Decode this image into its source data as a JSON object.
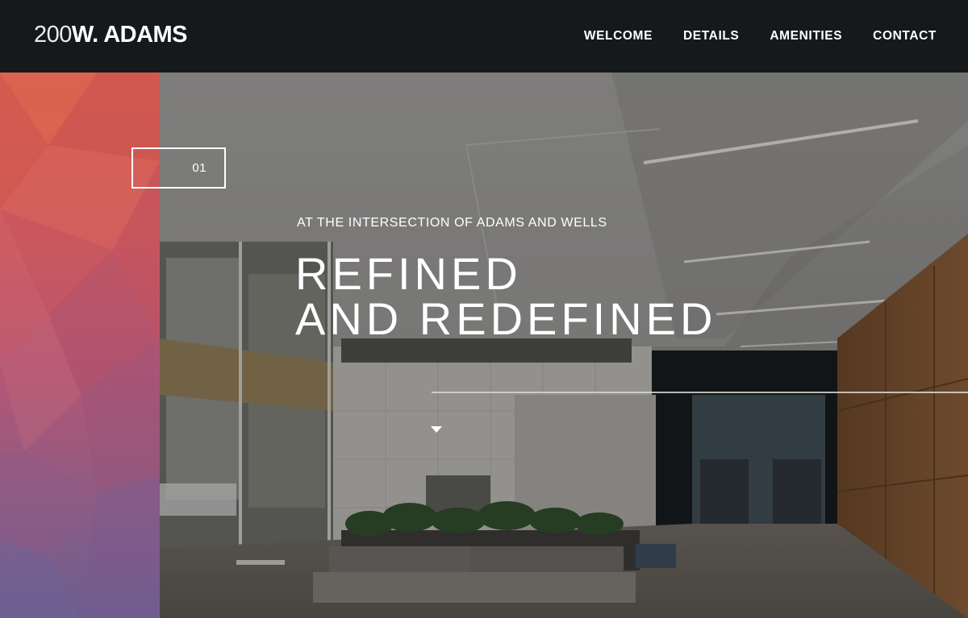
{
  "brand": {
    "logo_number": "200",
    "logo_name": "W. ADAMS"
  },
  "nav": {
    "items": [
      "WELCOME",
      "DETAILS",
      "AMENITIES",
      "CONTACT"
    ]
  },
  "hero": {
    "slide_number": "01",
    "eyebrow": "AT THE INTERSECTION OF ADAMS AND WELLS",
    "headline_line1": "REFINED",
    "headline_line2": "AND REDEFINED"
  },
  "colors": {
    "header_bg": "#16191c",
    "panel_top": "#d65d4e",
    "panel_bottom": "#6b5e90",
    "text": "#ffffff"
  },
  "icons": {
    "scroll": "triangle-down-icon"
  }
}
